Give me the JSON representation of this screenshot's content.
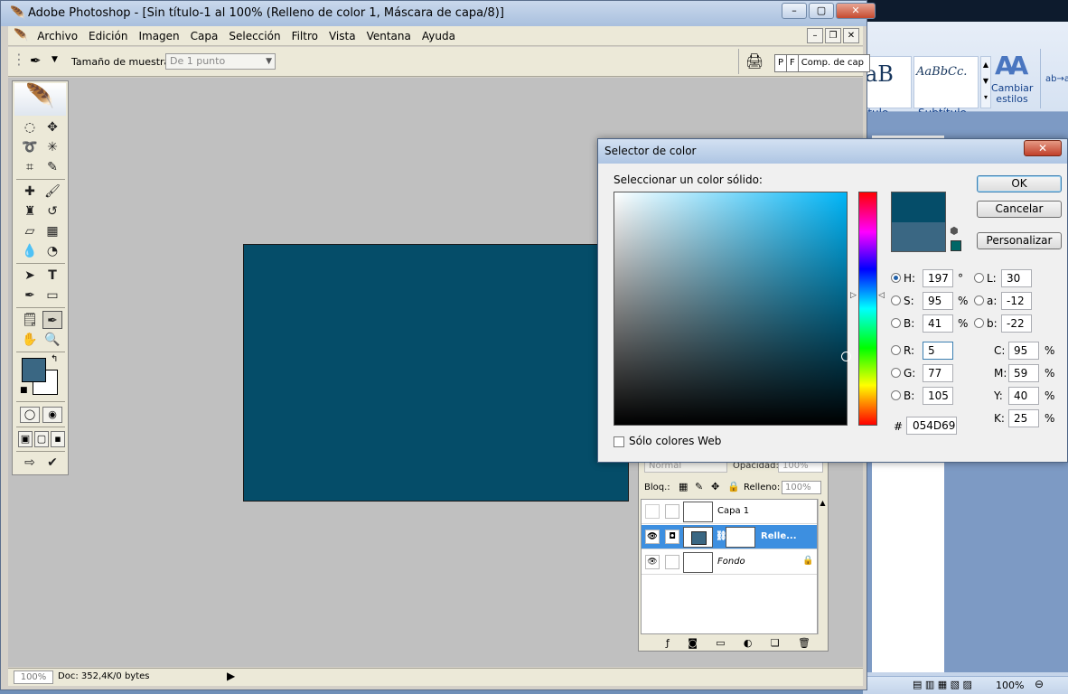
{
  "photoshop": {
    "title": "Adobe Photoshop - [Sin título-1 al 100% (Relleno de color 1, Máscara de capa/8)]",
    "menu": [
      "Archivo",
      "Edición",
      "Imagen",
      "Capa",
      "Selección",
      "Filtro",
      "Vista",
      "Ventana",
      "Ayuda"
    ],
    "options": {
      "sample_label": "Tamaño de muestra:",
      "sample_value": "De 1 punto",
      "palette_well": [
        "P",
        "F",
        "Comp. de cap"
      ]
    },
    "status": {
      "zoom": "100%",
      "doc": "Doc: 352,4K/0 bytes"
    },
    "colors": {
      "foreground": "#3a6783",
      "background": "#ffffff",
      "canvas_fill": "#054d69",
      "workspace": "#c0c0c0"
    }
  },
  "layers": {
    "blend_mode": "Normal",
    "opacity_label": "Opacidad:",
    "opacity_value": "100%",
    "lock_label": "Bloq.:",
    "fill_label": "Relleno:",
    "fill_value": "100%",
    "items": [
      {
        "name": "Capa 1",
        "visible": false,
        "selected": false
      },
      {
        "name": "Relle...",
        "visible": true,
        "selected": true
      },
      {
        "name": "Fondo",
        "visible": true,
        "selected": false,
        "locked": true
      }
    ]
  },
  "color_picker": {
    "title": "Selector de color",
    "select_label": "Seleccionar un color sólido:",
    "buttons": {
      "ok": "OK",
      "cancel": "Cancelar",
      "custom": "Personalizar"
    },
    "hsb": {
      "h_label": "H:",
      "h_value": "197",
      "h_unit": "°",
      "s_label": "S:",
      "s_value": "95",
      "s_unit": "%",
      "b_label": "B:",
      "b_value": "41",
      "b_unit": "%"
    },
    "lab": {
      "l_label": "L:",
      "l_value": "30",
      "a_label": "a:",
      "a_value": "-12",
      "b_label": "b:",
      "b_value": "-22"
    },
    "rgb": {
      "r_label": "R:",
      "r_value": "5",
      "g_label": "G:",
      "g_value": "77",
      "b_label": "B:",
      "b_value": "105"
    },
    "cmyk": {
      "c_label": "C:",
      "c_value": "95",
      "m_label": "M:",
      "m_value": "59",
      "y_label": "Y:",
      "y_value": "40",
      "k_label": "K:",
      "k_value": "25",
      "unit": "%"
    },
    "hex_prefix": "#",
    "hex": "054D69",
    "web_only_label": "Sólo colores Web",
    "colors": {
      "new": "#054d69",
      "current": "#3a6783",
      "web_safe": "#006666",
      "hue_pure": "#00b5f7"
    }
  },
  "word": {
    "styles": [
      {
        "sample": "aB",
        "caption": "ítulo"
      },
      {
        "sample": "AaBbCc.",
        "caption": "Subtítulo"
      }
    ],
    "change_styles_icon": "AA",
    "change_styles": "Cambiar estilos",
    "zoom": "100%"
  }
}
